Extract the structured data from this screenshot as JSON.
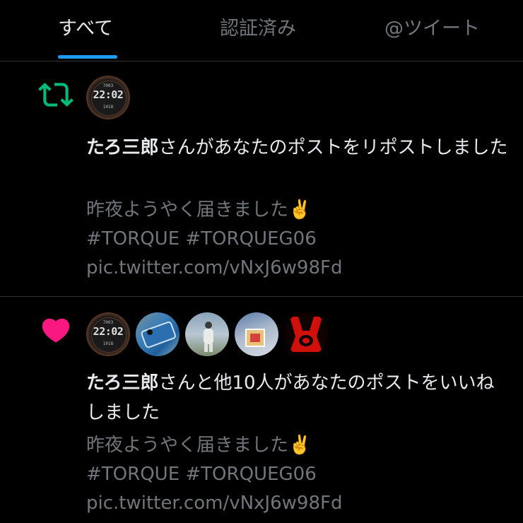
{
  "tabs": [
    {
      "label": "すべて",
      "active": true
    },
    {
      "label": "認証済み",
      "active": false
    },
    {
      "label": "@ツイート",
      "active": false
    }
  ],
  "colors": {
    "background": "#000000",
    "accent": "#1d9bf0",
    "repost_green": "#00ba7c",
    "like_pink": "#f91880",
    "secondary_text": "#71767b"
  },
  "notifications": [
    {
      "type_icon": "repost-icon",
      "avatars": [
        {
          "name": "watch-face-avatar",
          "time_text": "22:02",
          "top_text": "7003",
          "bottom_text": "1018"
        }
      ],
      "actor": "たろ三郎",
      "action": "さんがあなたのポストをリポストしました",
      "post_line1": "昨夜ようやく届きました✌️",
      "post_line2": "#TORQUE #TORQUEG06 pic.twitter.com/vNxJ6w98Fd"
    },
    {
      "type_icon": "heart-icon",
      "avatars": [
        {
          "name": "watch-face-avatar",
          "time_text": "22:02",
          "top_text": "7003",
          "bottom_text": "1018"
        },
        {
          "name": "phone-avatar"
        },
        {
          "name": "person-avatar"
        },
        {
          "name": "flag-avatar"
        },
        {
          "name": "red-graphic-avatar"
        }
      ],
      "actor": "たろ三郎",
      "action": "さんと他10人があなたのポストをいいねしました",
      "post_line1": "昨夜ようやく届きました✌️",
      "post_line2": "#TORQUE #TORQUEG06 pic.twitter.com/vNxJ6w98Fd"
    }
  ]
}
